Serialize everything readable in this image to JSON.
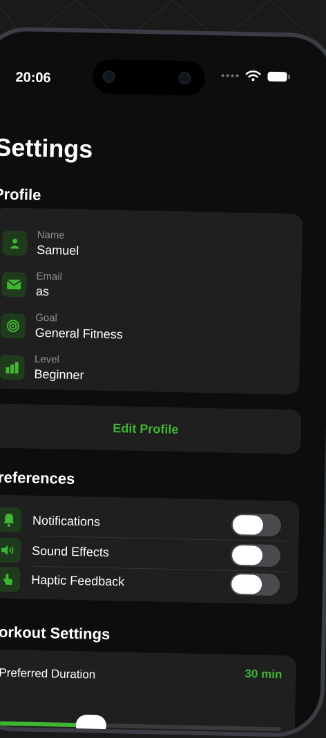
{
  "status": {
    "time": "20:06"
  },
  "page": {
    "title": "Settings"
  },
  "profile": {
    "section_title": "Profile",
    "fields": [
      {
        "label": "Name",
        "value": "Samuel",
        "icon": "person-icon"
      },
      {
        "label": "Email",
        "value": "as",
        "icon": "envelope-icon"
      },
      {
        "label": "Goal",
        "value": "General Fitness",
        "icon": "target-icon"
      },
      {
        "label": "Level",
        "value": "Beginner",
        "icon": "bar-chart-icon"
      }
    ],
    "edit_label": "Edit Profile"
  },
  "preferences": {
    "section_title": "Preferences",
    "items": [
      {
        "label": "Notifications",
        "icon": "bell-icon",
        "enabled": false
      },
      {
        "label": "Sound Effects",
        "icon": "speaker-icon",
        "enabled": false
      },
      {
        "label": "Haptic Feedback",
        "icon": "hand-tap-icon",
        "enabled": false
      }
    ]
  },
  "workout": {
    "section_title": "Workout Settings",
    "duration_label": "Preferred Duration",
    "duration_value": "30 min",
    "duration_fraction": 0.33
  },
  "colors": {
    "accent": "#3fb533",
    "background": "#0d0d0d",
    "card": "#1f1f1f",
    "icon_bg": "#1f3a1d"
  }
}
